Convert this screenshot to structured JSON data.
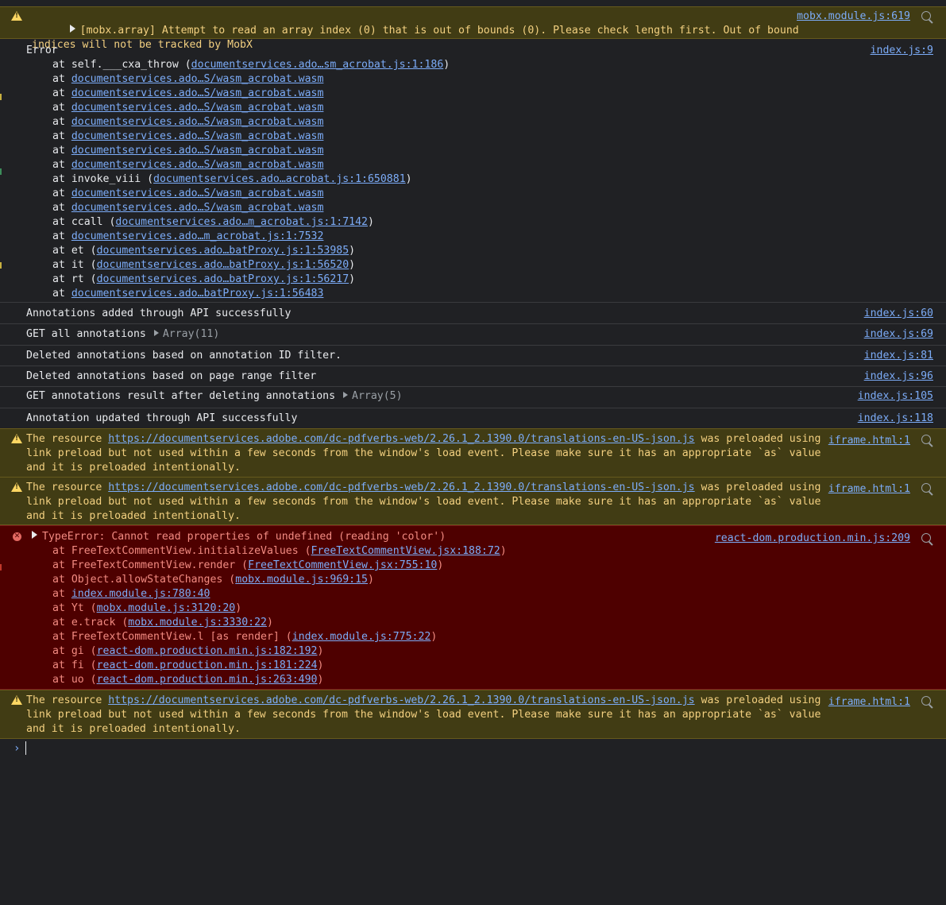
{
  "entries": [
    {
      "type": "warning",
      "expandable": true,
      "message": "[mobx.array] Attempt to read an array index (0) that is out of bounds (0). Please check length first. Out of bound indices will not be tracked by MobX",
      "source": "mobx.module.js:619"
    },
    {
      "type": "info",
      "message": "Error",
      "source": "index.js:9",
      "stack": [
        {
          "prefix": "at self.___cxa_throw (",
          "link": "documentservices.ado…sm_acrobat.js:1:186",
          "suffix": ")"
        },
        {
          "prefix": "at ",
          "link": "documentservices.ado…S/wasm_acrobat.wasm",
          "suffix": ""
        },
        {
          "prefix": "at ",
          "link": "documentservices.ado…S/wasm_acrobat.wasm",
          "suffix": ""
        },
        {
          "prefix": "at ",
          "link": "documentservices.ado…S/wasm_acrobat.wasm",
          "suffix": ""
        },
        {
          "prefix": "at ",
          "link": "documentservices.ado…S/wasm_acrobat.wasm",
          "suffix": ""
        },
        {
          "prefix": "at ",
          "link": "documentservices.ado…S/wasm_acrobat.wasm",
          "suffix": ""
        },
        {
          "prefix": "at ",
          "link": "documentservices.ado…S/wasm_acrobat.wasm",
          "suffix": ""
        },
        {
          "prefix": "at ",
          "link": "documentservices.ado…S/wasm_acrobat.wasm",
          "suffix": ""
        },
        {
          "prefix": "at invoke_viii (",
          "link": "documentservices.ado…acrobat.js:1:650881",
          "suffix": ")"
        },
        {
          "prefix": "at ",
          "link": "documentservices.ado…S/wasm_acrobat.wasm",
          "suffix": ""
        },
        {
          "prefix": "at ",
          "link": "documentservices.ado…S/wasm_acrobat.wasm",
          "suffix": ""
        },
        {
          "prefix": "at ccall (",
          "link": "documentservices.ado…m_acrobat.js:1:7142",
          "suffix": ")"
        },
        {
          "prefix": "at ",
          "link": "documentservices.ado…m_acrobat.js:1:7532",
          "suffix": ""
        },
        {
          "prefix": "at et (",
          "link": "documentservices.ado…batProxy.js:1:53985",
          "suffix": ")"
        },
        {
          "prefix": "at it (",
          "link": "documentservices.ado…batProxy.js:1:56520",
          "suffix": ")"
        },
        {
          "prefix": "at rt (",
          "link": "documentservices.ado…batProxy.js:1:56217",
          "suffix": ")"
        },
        {
          "prefix": "at ",
          "link": "documentservices.ado…batProxy.js:1:56483",
          "suffix": ""
        }
      ]
    },
    {
      "type": "info",
      "message": "Annotations added through API successfully",
      "source": "index.js:60"
    },
    {
      "type": "info",
      "message": "GET all annotations",
      "array": "Array(11)",
      "source": "index.js:69"
    },
    {
      "type": "info",
      "message": "Deleted annotations based on annotation ID filter.",
      "source": "index.js:81"
    },
    {
      "type": "info",
      "message": "Deleted annotations based on page range filter",
      "source": "index.js:96"
    },
    {
      "type": "info",
      "message": "GET annotations result after deleting annotations",
      "array": "Array(5)",
      "source": "index.js:105"
    },
    {
      "type": "info",
      "message": "Annotation updated through API successfully",
      "source": "index.js:118"
    },
    {
      "type": "warning",
      "message_prefix": "The resource ",
      "url": "https://documentservices.adobe.com/dc-pdfverbs-web/2.26.1_2.1390.0/translations-en-US-json.js",
      "message_suffix": " was preloaded using link preload but not used within a few seconds from the window's load event. Please make sure it has an appropriate `as` value and it is preloaded intentionally.",
      "source": "iframe.html:1"
    },
    {
      "type": "warning",
      "message_prefix": "The resource ",
      "url": "https://documentservices.adobe.com/dc-pdfverbs-web/2.26.1_2.1390.0/translations-en-US-json.js",
      "message_suffix": " was preloaded using link preload but not used within a few seconds from the window's load event. Please make sure it has an appropriate `as` value and it is preloaded intentionally.",
      "source": "iframe.html:1"
    },
    {
      "type": "error",
      "expandable": true,
      "message": "TypeError: Cannot read properties of undefined (reading 'color')",
      "source": "react-dom.production.min.js:209",
      "stack": [
        {
          "prefix": "at FreeTextCommentView.initializeValues (",
          "link": "FreeTextCommentView.jsx:188:72",
          "suffix": ")"
        },
        {
          "prefix": "at FreeTextCommentView.render (",
          "link": "FreeTextCommentView.jsx:755:10",
          "suffix": ")"
        },
        {
          "prefix": "at Object.allowStateChanges (",
          "link": "mobx.module.js:969:15",
          "suffix": ")"
        },
        {
          "prefix": "at ",
          "link": "index.module.js:780:40",
          "suffix": ""
        },
        {
          "prefix": "at Yt (",
          "link": "mobx.module.js:3120:20",
          "suffix": ")"
        },
        {
          "prefix": "at e.track (",
          "link": "mobx.module.js:3330:22",
          "suffix": ")"
        },
        {
          "prefix": "at FreeTextCommentView.l [as render] (",
          "link": "index.module.js:775:22",
          "suffix": ")"
        },
        {
          "prefix": "at gi (",
          "link": "react-dom.production.min.js:182:192",
          "suffix": ")"
        },
        {
          "prefix": "at fi (",
          "link": "react-dom.production.min.js:181:224",
          "suffix": ")"
        },
        {
          "prefix": "at uo (",
          "link": "react-dom.production.min.js:263:490",
          "suffix": ")"
        }
      ]
    },
    {
      "type": "warning",
      "message_prefix": "The resource ",
      "url": "https://documentservices.adobe.com/dc-pdfverbs-web/2.26.1_2.1390.0/translations-en-US-json.js",
      "message_suffix": " was preloaded using link preload but not used within a few seconds from the window's load event. Please make sure it has an appropriate `as` value and it is preloaded intentionally.",
      "source": "iframe.html:1"
    }
  ],
  "prompt_symbol": "›",
  "colors": {
    "background": "#202124",
    "warning_bg": "#413c14",
    "warning_text": "#f3d080",
    "error_bg": "#4e0000",
    "error_text": "#f28b82",
    "link": "#7cacf8"
  }
}
